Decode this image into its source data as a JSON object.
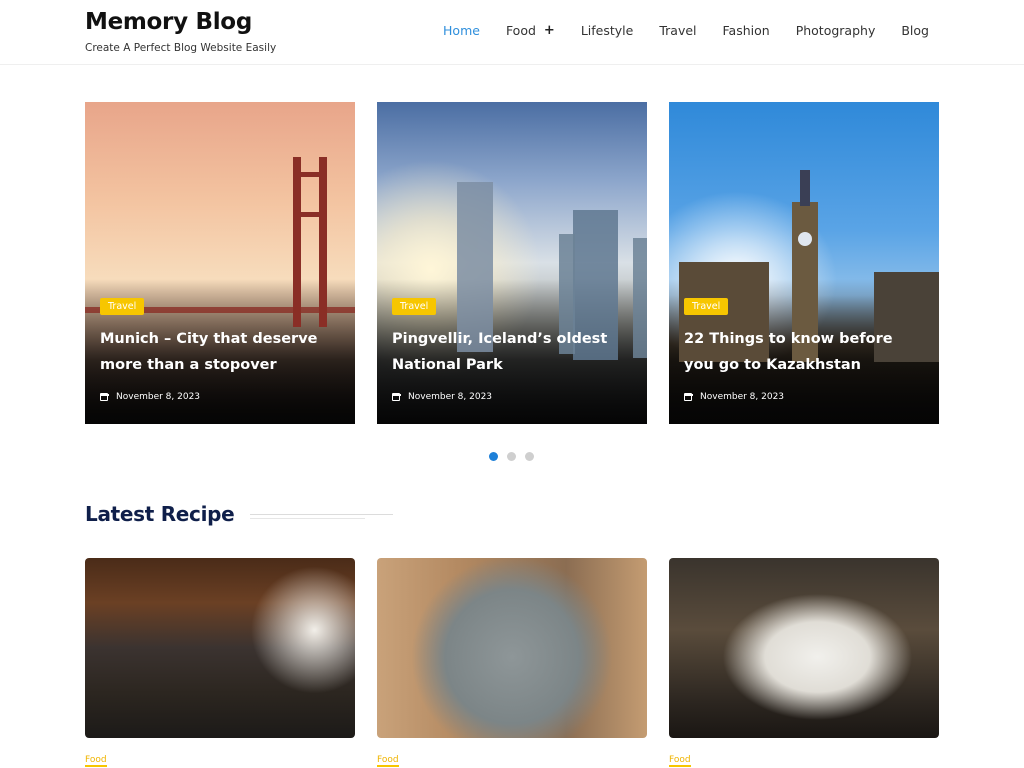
{
  "header": {
    "site_title": "Memory Blog",
    "tagline": "Create A Perfect Blog Website Easily",
    "nav": [
      {
        "label": "Home",
        "active": true
      },
      {
        "label": "Food",
        "has_submenu": true,
        "submenu_icon": "+"
      },
      {
        "label": "Lifestyle"
      },
      {
        "label": "Travel"
      },
      {
        "label": "Fashion"
      },
      {
        "label": "Photography"
      },
      {
        "label": "Blog"
      }
    ]
  },
  "slider": {
    "slides": [
      {
        "category": "Travel",
        "title": "Munich – City that deserve more than a stopover",
        "date": "November 8, 2023",
        "image": "golden-gate-bridge-sunset"
      },
      {
        "category": "Travel",
        "title": "Pingvellir, Iceland’s oldest National Park",
        "date": "November 8, 2023",
        "image": "city-skyline-sunrise"
      },
      {
        "category": "Travel",
        "title": "22 Things to know before you go to Kazakhstan",
        "date": "November 8, 2023",
        "image": "big-ben-london"
      }
    ],
    "pagination": {
      "total": 3,
      "active_index": 0
    }
  },
  "latest_recipe": {
    "heading": "Latest Recipe",
    "items": [
      {
        "category": "Food",
        "image": "busy-bar-interior"
      },
      {
        "category": "Food",
        "image": "brunch-table-overhead"
      },
      {
        "category": "Food",
        "image": "restaurant-dining-plate"
      }
    ]
  },
  "colors": {
    "accent_blue": "#1e80d8",
    "badge_yellow": "#f7c600",
    "heading_navy": "#0f1f4a"
  }
}
